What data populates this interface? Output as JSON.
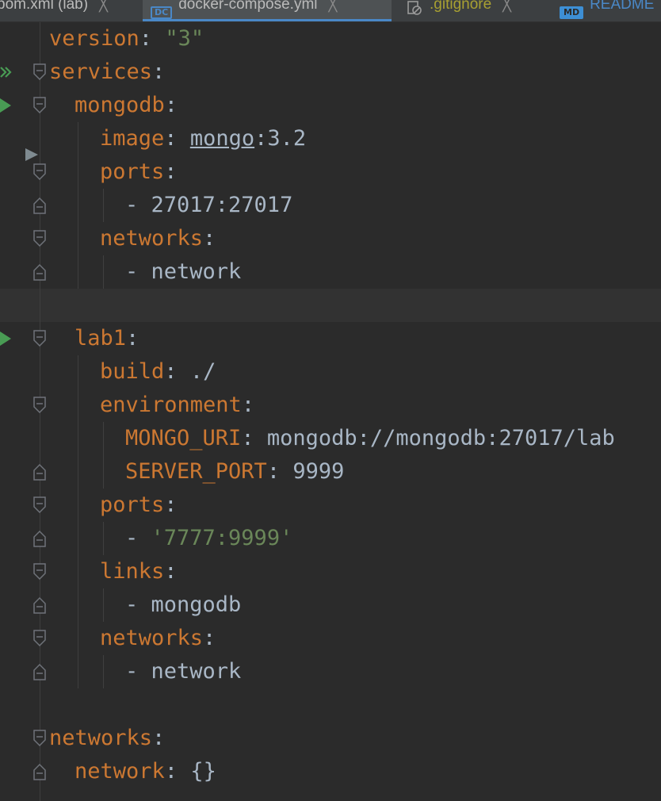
{
  "tabs": [
    {
      "label": "pom.xml (lab)",
      "close": "╳"
    },
    {
      "badge": "DC",
      "label": "docker-compose.yml",
      "close": "╳"
    },
    {
      "label": ".gitignore",
      "close": "╳"
    },
    {
      "badge": "MD",
      "label": "README"
    }
  ],
  "code": {
    "version_key": "version",
    "version_val": "\"3\"",
    "services_key": "services",
    "mongodb_key": "mongodb",
    "image_key": "image",
    "image_val_link": "mongo",
    "image_val_tag": ":3.2",
    "ports_key": "ports",
    "mongodb_port": "- 27017:27017",
    "networks_key": "networks",
    "network_item": "- network",
    "lab1_key": "lab1",
    "build_key": "build",
    "build_val": "./",
    "environment_key": "environment",
    "mongo_uri_key": "MONGO_URI",
    "mongo_uri_val": "mongodb://mongodb:27017/lab",
    "server_port_key": "SERVER_PORT",
    "server_port_val": "9999",
    "lab1_port_dash": "- ",
    "lab1_port": "'7777:9999'",
    "links_key": "links",
    "links_item": "- mongodb",
    "network_key": "network",
    "network_val": "{}",
    "colon": ":"
  },
  "colors": {
    "background": "#2b2b2b",
    "keyword": "#cc7832",
    "string": "#6a8759",
    "text": "#a9b7c6",
    "run": "#499c54",
    "accent": "#4a88c7"
  }
}
